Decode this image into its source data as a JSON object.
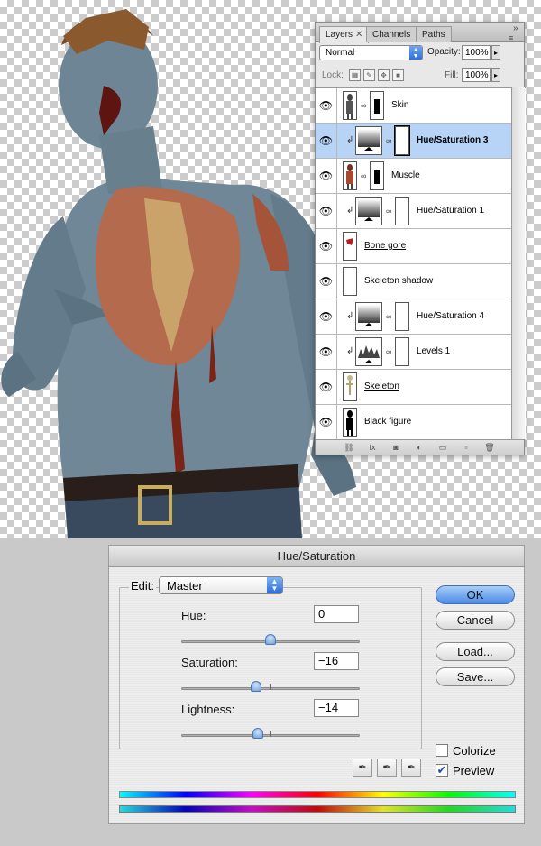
{
  "layers_panel": {
    "tabs": [
      {
        "label": "Layers",
        "active": true
      },
      {
        "label": "Channels",
        "active": false
      },
      {
        "label": "Paths",
        "active": false
      }
    ],
    "blend_mode": "Normal",
    "opacity_label": "Opacity:",
    "opacity_value": "100%",
    "lock_label": "Lock:",
    "fill_label": "Fill:",
    "fill_value": "100%",
    "layers": [
      {
        "name": "Skin",
        "visible": true,
        "selected": false,
        "clipped": false,
        "has_mask": true,
        "style": "normal",
        "thumb": "figure"
      },
      {
        "name": "Hue/Saturation 3",
        "visible": true,
        "selected": true,
        "clipped": true,
        "has_mask": true,
        "style": "bold",
        "thumb": "adjustment"
      },
      {
        "name": "Muscle",
        "visible": true,
        "selected": false,
        "clipped": false,
        "has_mask": true,
        "style": "underline",
        "thumb": "figure-red"
      },
      {
        "name": "Hue/Saturation 1",
        "visible": true,
        "selected": false,
        "clipped": true,
        "has_mask": true,
        "style": "normal",
        "thumb": "adjustment"
      },
      {
        "name": "Bone gore",
        "visible": true,
        "selected": false,
        "clipped": false,
        "has_mask": false,
        "style": "underline",
        "thumb": "gore"
      },
      {
        "name": "Skeleton shadow",
        "visible": true,
        "selected": false,
        "clipped": false,
        "has_mask": false,
        "style": "normal",
        "thumb": "empty"
      },
      {
        "name": "Hue/Saturation 4",
        "visible": true,
        "selected": false,
        "clipped": true,
        "has_mask": true,
        "style": "normal",
        "thumb": "adjustment"
      },
      {
        "name": "Levels 1",
        "visible": true,
        "selected": false,
        "clipped": true,
        "has_mask": true,
        "style": "normal",
        "thumb": "levels"
      },
      {
        "name": "Skeleton",
        "visible": true,
        "selected": false,
        "clipped": false,
        "has_mask": false,
        "style": "underline",
        "thumb": "skeleton"
      },
      {
        "name": "Black figure",
        "visible": true,
        "selected": false,
        "clipped": false,
        "has_mask": false,
        "style": "normal",
        "thumb": "black"
      }
    ],
    "footer_icons": [
      "link-icon",
      "fx-icon",
      "mask-icon",
      "adjustment-icon",
      "folder-icon",
      "new-layer-icon",
      "trash-icon"
    ]
  },
  "dialog": {
    "title": "Hue/Saturation",
    "edit_label": "Edit:",
    "edit_value": "Master",
    "hue": {
      "label": "Hue:",
      "value": "0",
      "slider_fraction": 0.5
    },
    "saturation": {
      "label": "Saturation:",
      "value": "−16",
      "slider_fraction": 0.42
    },
    "lightness": {
      "label": "Lightness:",
      "value": "−14",
      "slider_fraction": 0.43
    },
    "buttons": {
      "ok": "OK",
      "cancel": "Cancel",
      "load": "Load...",
      "save": "Save..."
    },
    "colorize": {
      "label": "Colorize",
      "checked": false
    },
    "preview": {
      "label": "Preview",
      "checked": true
    },
    "colors": {
      "default_button": "#4b8be6"
    }
  }
}
